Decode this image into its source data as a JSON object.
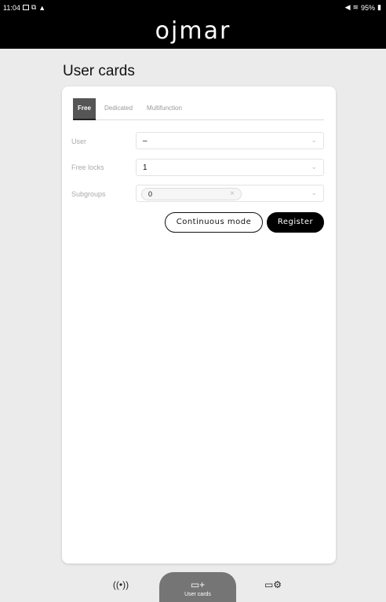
{
  "status_bar": {
    "time": "11:04",
    "battery": "95%",
    "left_icons": [
      "gallery-icon",
      "cast-icon",
      "alert-icon"
    ],
    "right_icons": [
      "mute-icon",
      "wifi-icon",
      "battery-icon"
    ]
  },
  "app": {
    "logo": "ojmar"
  },
  "page": {
    "title": "User cards"
  },
  "tabs": [
    {
      "label": "Free",
      "active": true
    },
    {
      "label": "Dedicated",
      "active": false
    },
    {
      "label": "Multifunction",
      "active": false
    }
  ],
  "form": {
    "user": {
      "label": "User",
      "value": "–"
    },
    "free_locks": {
      "label": "Free locks",
      "value": "1"
    },
    "subgroups": {
      "label": "Subgroups",
      "chip_value": "0"
    }
  },
  "buttons": {
    "continuous_mode": "Continuous mode",
    "register": "Register"
  },
  "bottom_nav": {
    "items": [
      {
        "icon": "broadcast-icon",
        "label": ""
      },
      {
        "icon": "add-card-icon",
        "label": "User cards",
        "active": true
      },
      {
        "icon": "card-settings-icon",
        "label": ""
      }
    ]
  }
}
